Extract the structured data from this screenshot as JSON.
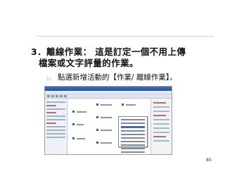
{
  "slide": {
    "heading_number": "3．",
    "heading_line1": "離線作業： 這是訂定一個不用上傳",
    "heading_line2": "檔案或文字評量的作業。",
    "bullet_marker": "1)",
    "bullet_text": "點選新增活動的【作業/ 離線作業】。",
    "page_number": "80"
  },
  "colors": {
    "title_bar": "#2452a8",
    "accent_red": "#c86b5f",
    "node_blue": "#2e5fb0"
  }
}
